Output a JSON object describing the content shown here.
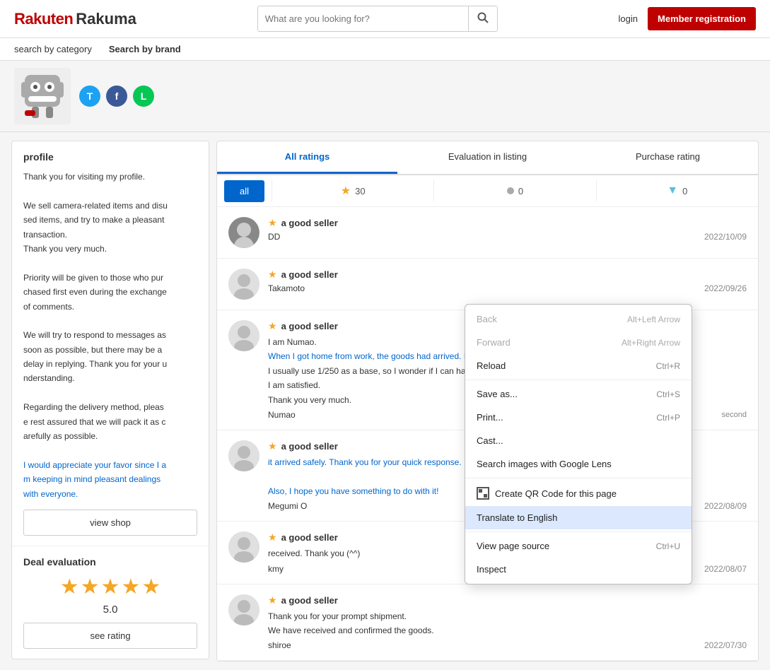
{
  "header": {
    "logo": "Rakuten Rakuma",
    "search_placeholder": "What are you looking for?",
    "login_label": "login",
    "member_reg_label": "Member registration"
  },
  "sub_nav": {
    "items": [
      {
        "label": "search by category"
      },
      {
        "label": "Search by brand"
      }
    ]
  },
  "social": {
    "twitter_label": "T",
    "facebook_label": "f",
    "line_label": "L"
  },
  "sidebar": {
    "profile_title": "profile",
    "profile_texts": [
      "Thank you for visiting my profile.",
      "We sell camera-related items and disused items, and try to make a pleasant transaction.\nThank you very much.",
      "Priority will be given to those who purchased first even during the exchange of comments.",
      "We will try to respond to messages as soon as possible, but there may be a delay in replying. Thank you for your understanding.",
      "Regarding the delivery method, please rest assured that we will pack it as carefully as possible.",
      "I would appreciate your favor since I am keeping in mind pleasant dealings with everyone."
    ],
    "view_shop_label": "view shop",
    "deal_eval_title": "Deal evaluation",
    "rating_score": "5.0",
    "see_rating_label": "see rating"
  },
  "ratings": {
    "tab_all": "All ratings",
    "tab_listing": "Evaluation in listing",
    "tab_purchase": "Purchase rating",
    "filter_all": "all",
    "stat_positive": "30",
    "stat_neutral": "0",
    "stat_negative": "0",
    "reviews": [
      {
        "title": "a good seller",
        "author": "DD",
        "date": "2022/10/09",
        "text": "",
        "has_avatar": true
      },
      {
        "title": "a good seller",
        "author": "Takamoto",
        "date": "2022/09/26",
        "text": "",
        "has_avatar": false
      },
      {
        "title": "a good seller",
        "author": "Numao",
        "date": "",
        "second_text": "second",
        "text": "I am Numao.\nWhen I got home from work, the goods had arrived. It's ce... cuts quickly).\nI usually use 1/250 as a base, so I wonder if I can handle t...\nI am satisfied.\nThank you very much.",
        "has_avatar": false
      },
      {
        "title": "a good seller",
        "author": "Megumi O",
        "date": "2022/08/09",
        "text": "it arrived safely. Thank you for your quick response. I am h... much.\n\nAlso, I hope you have something to do with it!",
        "has_avatar": false
      },
      {
        "title": "a good seller",
        "author": "kmy",
        "date": "2022/08/07",
        "text": "received. Thank you (^^)",
        "has_avatar": false
      },
      {
        "title": "a good seller",
        "author": "shiroe",
        "date": "2022/07/30",
        "text": "Thank you for your prompt shipment.\nWe have received and confirmed the goods.",
        "has_avatar": false
      }
    ]
  },
  "context_menu": {
    "items": [
      {
        "label": "Back",
        "shortcut": "Alt+Left Arrow",
        "disabled": false,
        "highlighted": false,
        "has_icon": false
      },
      {
        "label": "Forward",
        "shortcut": "Alt+Right Arrow",
        "disabled": false,
        "highlighted": false,
        "has_icon": false
      },
      {
        "label": "Reload",
        "shortcut": "Ctrl+R",
        "disabled": false,
        "highlighted": false,
        "has_icon": false
      },
      {
        "label": "Save as...",
        "shortcut": "Ctrl+S",
        "disabled": false,
        "highlighted": false,
        "has_icon": false
      },
      {
        "label": "Print...",
        "shortcut": "Ctrl+P",
        "disabled": false,
        "highlighted": false,
        "has_icon": false
      },
      {
        "label": "Cast...",
        "shortcut": "",
        "disabled": false,
        "highlighted": false,
        "has_icon": false
      },
      {
        "label": "Search images with Google Lens",
        "shortcut": "",
        "disabled": false,
        "highlighted": false,
        "has_icon": false
      },
      {
        "label": "Create QR Code for this page",
        "shortcut": "",
        "disabled": false,
        "highlighted": false,
        "has_icon": true
      },
      {
        "label": "Translate to English",
        "shortcut": "",
        "disabled": false,
        "highlighted": true,
        "has_icon": false
      },
      {
        "label": "View page source",
        "shortcut": "Ctrl+U",
        "disabled": false,
        "highlighted": false,
        "has_icon": false
      },
      {
        "label": "Inspect",
        "shortcut": "",
        "disabled": false,
        "highlighted": false,
        "has_icon": false
      }
    ]
  }
}
